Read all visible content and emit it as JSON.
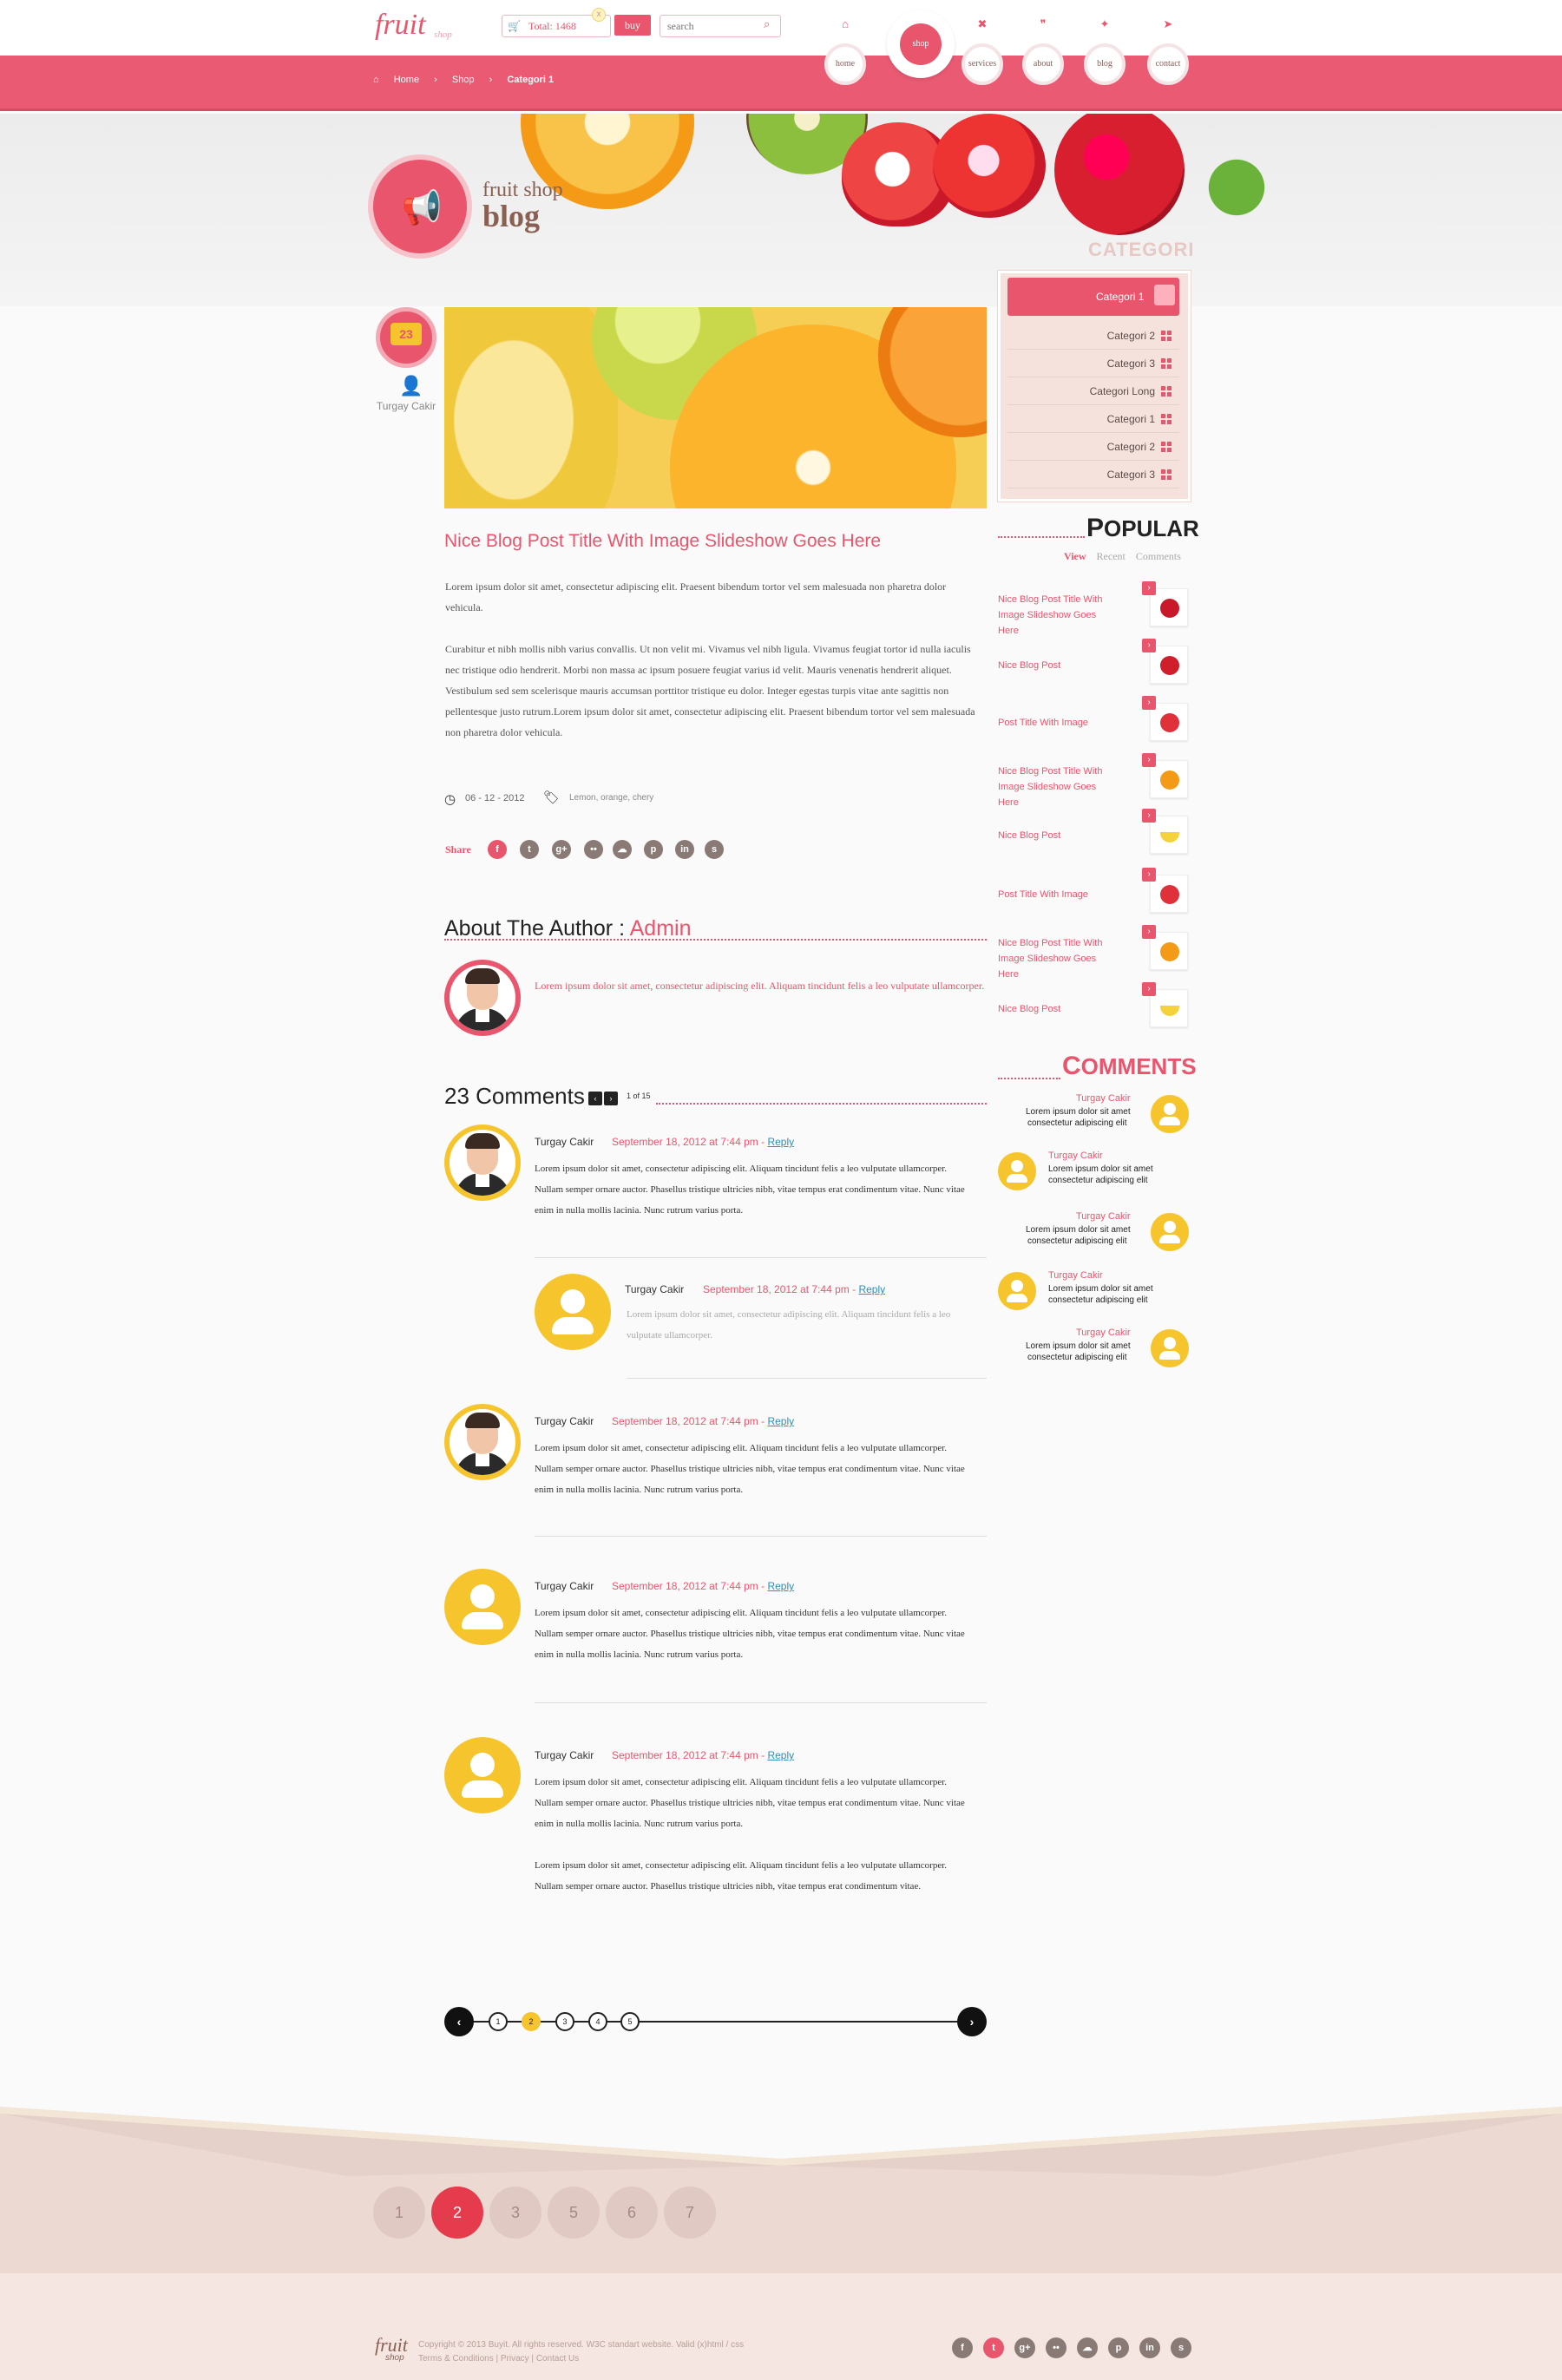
{
  "header": {
    "logo": "fruit",
    "logo_sub": "shop",
    "cart_total": "Total: 1468",
    "cart_count": "x",
    "buy_label": "buy",
    "search_placeholder": "search",
    "nav": [
      {
        "label": "home",
        "icon": "home-icon"
      },
      {
        "label": "shop",
        "icon": "shop-icon",
        "active": true
      },
      {
        "label": "services",
        "icon": "tools-icon"
      },
      {
        "label": "about",
        "icon": "quote-icon"
      },
      {
        "label": "blog",
        "icon": "megaphone-icon"
      },
      {
        "label": "contact",
        "icon": "send-icon"
      }
    ]
  },
  "breadcrumb": [
    "Home",
    "Shop",
    "Categori 1"
  ],
  "hero": {
    "line1": "fruit shop",
    "line2": "blog"
  },
  "post": {
    "comment_count": "23",
    "author": "Turgay Cakir",
    "title": "Nice Blog Post Title With Image Slideshow Goes Here",
    "para1": "Lorem ipsum dolor sit amet, consectetur adipiscing elit. Praesent bibendum tortor vel sem malesuada non pharetra dolor vehicula.",
    "para2": "Curabitur et nibh mollis nibh varius convallis. Ut non velit mi. Vivamus vel nibh ligula. Vivamus feugiat tortor id nulla iaculis nec tristique odio hendrerit. Morbi non massa ac ipsum posuere feugiat varius id velit. Mauris venenatis hendrerit aliquet. Vestibulum sed sem scelerisque mauris accumsan porttitor tristique eu dolor. Integer egestas turpis vitae ante sagittis non pellentesque justo rutrum.Lorem ipsum dolor sit amet, consectetur adipiscing elit. Praesent bibendum tortor vel sem malesuada non pharetra dolor vehicula.",
    "date": "06 - 12 - 2012",
    "tags": "Lemon, orange, chery",
    "share_label": "Share",
    "share_icons": [
      "f",
      "t",
      "g+",
      "••",
      "☁",
      "p",
      "in",
      "s"
    ]
  },
  "about": {
    "title": "About The Author :",
    "name": "Admin",
    "text": "Lorem ipsum dolor sit amet, consectetur adipiscing elit. Aliquam tincidunt felis a leo vulputate ullamcorper."
  },
  "comments": {
    "title": "23 Comments",
    "prev": "‹",
    "next": "›",
    "page_info": "1 of 15",
    "items": [
      {
        "name": "Turgay Cakir",
        "date": "September 18, 2012 at 7:44 pm",
        "dash": " - ",
        "reply": "Reply",
        "text": "Lorem ipsum dolor sit amet, consectetur adipiscing elit. Aliquam tincidunt felis a leo vulputate ullamcorper. Nullam semper ornare auctor. Phasellus tristique ultricies nibh, vitae tempus erat condimentum vitae. Nunc vitae enim in nulla mollis lacinia. Nunc rutrum varius porta."
      },
      {
        "name": "Turgay Cakir",
        "date": "September 18, 2012 at 7:44 pm",
        "dash": " - ",
        "reply": "Reply",
        "text": "Lorem ipsum dolor sit amet, consectetur adipiscing elit. Aliquam tincidunt felis a leo vulputate ullamcorper."
      },
      {
        "name": "Turgay Cakir",
        "date": "September 18, 2012 at 7:44 pm",
        "dash": " - ",
        "reply": "Reply",
        "text": "Lorem ipsum dolor sit amet, consectetur adipiscing elit. Aliquam tincidunt felis a leo vulputate ullamcorper. Nullam semper ornare auctor. Phasellus tristique ultricies nibh, vitae tempus erat condimentum vitae. Nunc vitae enim in nulla mollis lacinia. Nunc rutrum varius porta."
      },
      {
        "name": "Turgay Cakir",
        "date": "September 18, 2012 at 7:44 pm",
        "dash": " - ",
        "reply": "Reply",
        "text": "Lorem ipsum dolor sit amet, consectetur adipiscing elit. Aliquam tincidunt felis a leo vulputate ullamcorper. Nullam semper ornare auctor. Phasellus tristique ultricies nibh, vitae tempus erat condimentum vitae. Nunc vitae enim in nulla mollis lacinia. Nunc rutrum varius porta."
      },
      {
        "name": "Turgay Cakir",
        "date": "September 18, 2012 at 7:44 pm",
        "dash": " - ",
        "reply": "Reply",
        "text": "Lorem ipsum dolor sit amet, consectetur adipiscing elit. Aliquam tincidunt felis a leo vulputate ullamcorper. Nullam semper ornare auctor. Phasellus tristique ultricies nibh, vitae tempus erat condimentum vitae. Nunc vitae enim in nulla mollis lacinia. Nunc rutrum varius porta.",
        "text2": "Lorem ipsum dolor sit amet, consectetur adipiscing elit. Aliquam tincidunt felis a leo vulputate ullamcorper. Nullam semper ornare auctor. Phasellus tristique ultricies nibh, vitae tempus erat condimentum vitae."
      }
    ]
  },
  "pager": {
    "prev": "‹",
    "next": "›",
    "pages": [
      "1",
      "2",
      "3",
      "4",
      "5"
    ],
    "current": "2"
  },
  "sidebar": {
    "categori_title": "CATEGORI",
    "categories": [
      "Categori 1",
      "Categori 2",
      "Categori 3",
      "Categori Long",
      "Categori 1",
      "Categori 2",
      "Categori 3"
    ],
    "popular_title_first": "P",
    "popular_title_rest": "OPULAR",
    "popular_tabs": [
      "View",
      "Recent",
      "Comments"
    ],
    "popular_items": [
      {
        "title": "Nice Blog Post Title With Image Slideshow Goes Here",
        "fruit": "cherry",
        "color": "#c8182a"
      },
      {
        "title": "Nice Blog Post",
        "fruit": "apple",
        "color": "#d01f2b"
      },
      {
        "title": "Post Title With Image",
        "fruit": "strawberry",
        "color": "#e0303a"
      },
      {
        "title": "Nice Blog Post Title With Image Slideshow Goes Here",
        "fruit": "orange",
        "color": "#f39a16"
      },
      {
        "title": "Nice Blog Post",
        "fruit": "banana",
        "color": "#f3d23a"
      },
      {
        "title": "Post Title With Image",
        "fruit": "strawberry",
        "color": "#e0303a"
      },
      {
        "title": "Nice Blog Post Title With Image Slideshow Goes Here",
        "fruit": "orange",
        "color": "#f39a16"
      },
      {
        "title": "Nice Blog Post",
        "fruit": "banana",
        "color": "#f3d23a"
      }
    ],
    "comments_title_first": "C",
    "comments_title_rest": "OMMENTS",
    "comments": [
      {
        "name": "Turgay Cakir",
        "line1": "Lorem ipsum dolor sit amet",
        "line2": "consectetur adipiscing elit"
      },
      {
        "name": "Turgay Cakir",
        "line1": "Lorem ipsum dolor sit amet",
        "line2": "consectetur adipiscing elit"
      },
      {
        "name": "Turgay Cakir",
        "line1": "Lorem ipsum dolor sit amet",
        "line2": "consectetur adipiscing elit"
      },
      {
        "name": "Turgay Cakir",
        "line1": "Lorem ipsum dolor sit amet",
        "line2": "consectetur adipiscing elit"
      },
      {
        "name": "Turgay Cakir",
        "line1": "Lorem ipsum dolor sit amet",
        "line2": "consectetur adipiscing elit"
      }
    ]
  },
  "footer": {
    "pages": [
      "1",
      "2",
      "3",
      "5",
      "6",
      "7"
    ],
    "current": "2",
    "logo": "fruit",
    "logo_sub": "shop",
    "copyright": "Copyright © 2013 Buyit. All rights reserved. W3C standart website. Valid (x)html / css",
    "links": [
      "Terms & Conditions",
      "Privacy",
      "Contact Us"
    ],
    "link_sep": " | ",
    "social": [
      "f",
      "t",
      "g+",
      "••",
      "☁",
      "p",
      "in",
      "s"
    ]
  },
  "colors": {
    "accent": "#e8556c",
    "yellow": "#f6c52d",
    "brown": "#8a6053",
    "footer": "#ecd9d2"
  }
}
